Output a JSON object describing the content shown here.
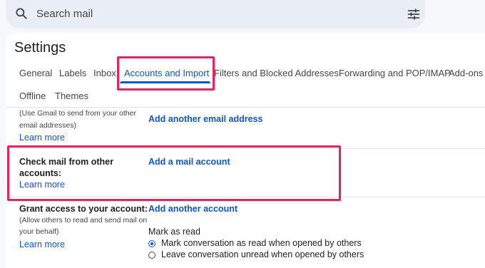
{
  "search": {
    "placeholder": "Search mail",
    "search_icon": "search-icon",
    "filter_icon": "tune-icon"
  },
  "settings": {
    "title": "Settings",
    "tabs": [
      {
        "label": "General",
        "active": false
      },
      {
        "label": "Labels",
        "active": false
      },
      {
        "label": "Inbox",
        "active": false
      },
      {
        "label": "Accounts and Import",
        "active": true
      },
      {
        "label": "Filters and Blocked Addresses",
        "active": false
      },
      {
        "label": "Forwarding and POP/IMAP",
        "active": false
      },
      {
        "label": "Add-ons",
        "active": false
      },
      {
        "label": "Offline",
        "active": false
      },
      {
        "label": "Themes",
        "active": false
      }
    ]
  },
  "sections": {
    "send_as": {
      "desc_line1": "(Use Gmail to send from your other",
      "desc_line2": "email addresses)",
      "learn_more": "Learn more",
      "action": "Add another email address"
    },
    "check_mail": {
      "label_line1": "Check mail from other",
      "label_line2": "accounts:",
      "learn_more": "Learn more",
      "action": "Add a mail account"
    },
    "grant_access": {
      "label": "Grant access to your account:",
      "desc_line1": "(Allow others to read and send mail on",
      "desc_line2": "your behalf)",
      "learn_more": "Learn more",
      "action": "Add another account",
      "mark_as_read_label": "Mark as read",
      "options": [
        {
          "label": "Mark conversation as read when opened by others",
          "checked": true
        },
        {
          "label": "Leave conversation unread when opened by others",
          "checked": false
        }
      ]
    }
  },
  "colors": {
    "accent": "#0b57d0",
    "highlight": "#e0245e"
  }
}
